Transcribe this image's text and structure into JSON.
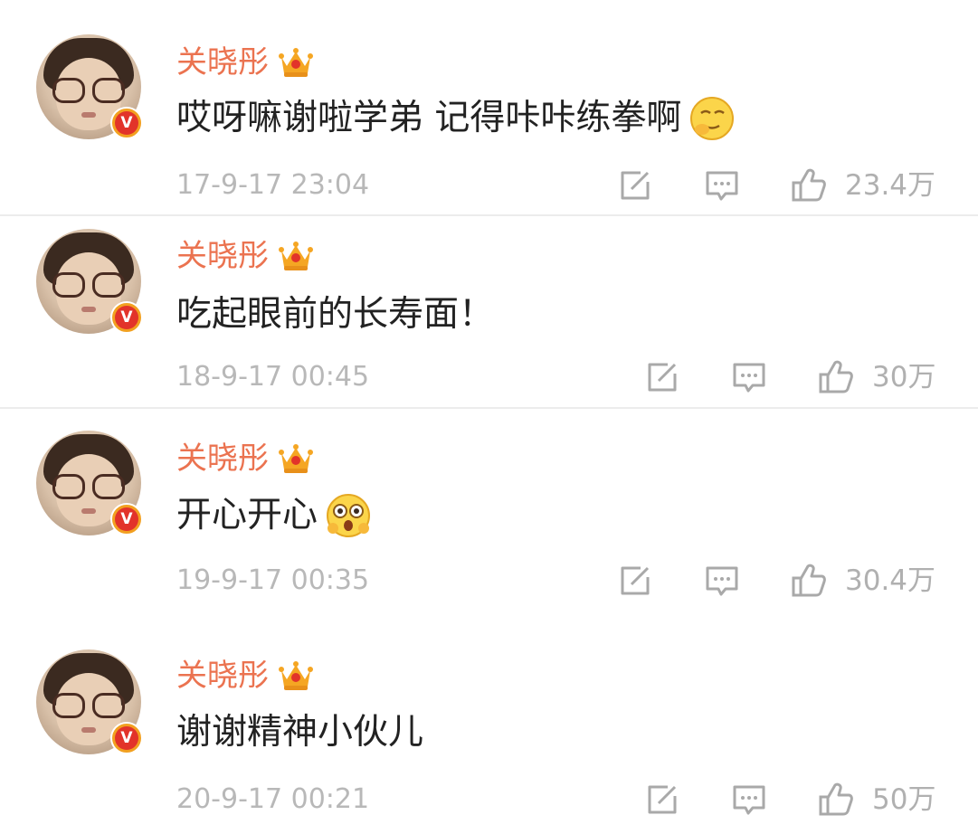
{
  "comments": [
    {
      "username": "关晓彤",
      "content": "哎呀嘛谢啦学弟 记得咔咔练拳啊",
      "emoji": "smirk-emoji",
      "timestamp": "17-9-17 23:04",
      "likes": "23.4万"
    },
    {
      "username": "关晓彤",
      "content": "吃起眼前的长寿面！",
      "emoji": "",
      "timestamp": "18-9-17 00:45",
      "likes": "30万"
    },
    {
      "username": "关晓彤",
      "content": "开心开心",
      "emoji": "excited-emoji",
      "timestamp": "19-9-17 00:35",
      "likes": "30.4万"
    },
    {
      "username": "关晓彤",
      "content": "谢谢精神小伙儿",
      "emoji": "",
      "timestamp": "20-9-17 00:21",
      "likes": "50万"
    }
  ],
  "badge": {
    "verified_letter": "V"
  },
  "colors": {
    "username": "#eb7350",
    "timestamp": "#b8b8b8",
    "content": "#222222",
    "icon": "#a9a9a9",
    "verified_badge": "#e2332a",
    "crown": "#f5a623"
  },
  "icons": {
    "share": "share-icon",
    "comment": "comment-icon",
    "like": "thumbs-up-icon",
    "crown": "crown-icon",
    "verified": "verified-badge-icon"
  }
}
